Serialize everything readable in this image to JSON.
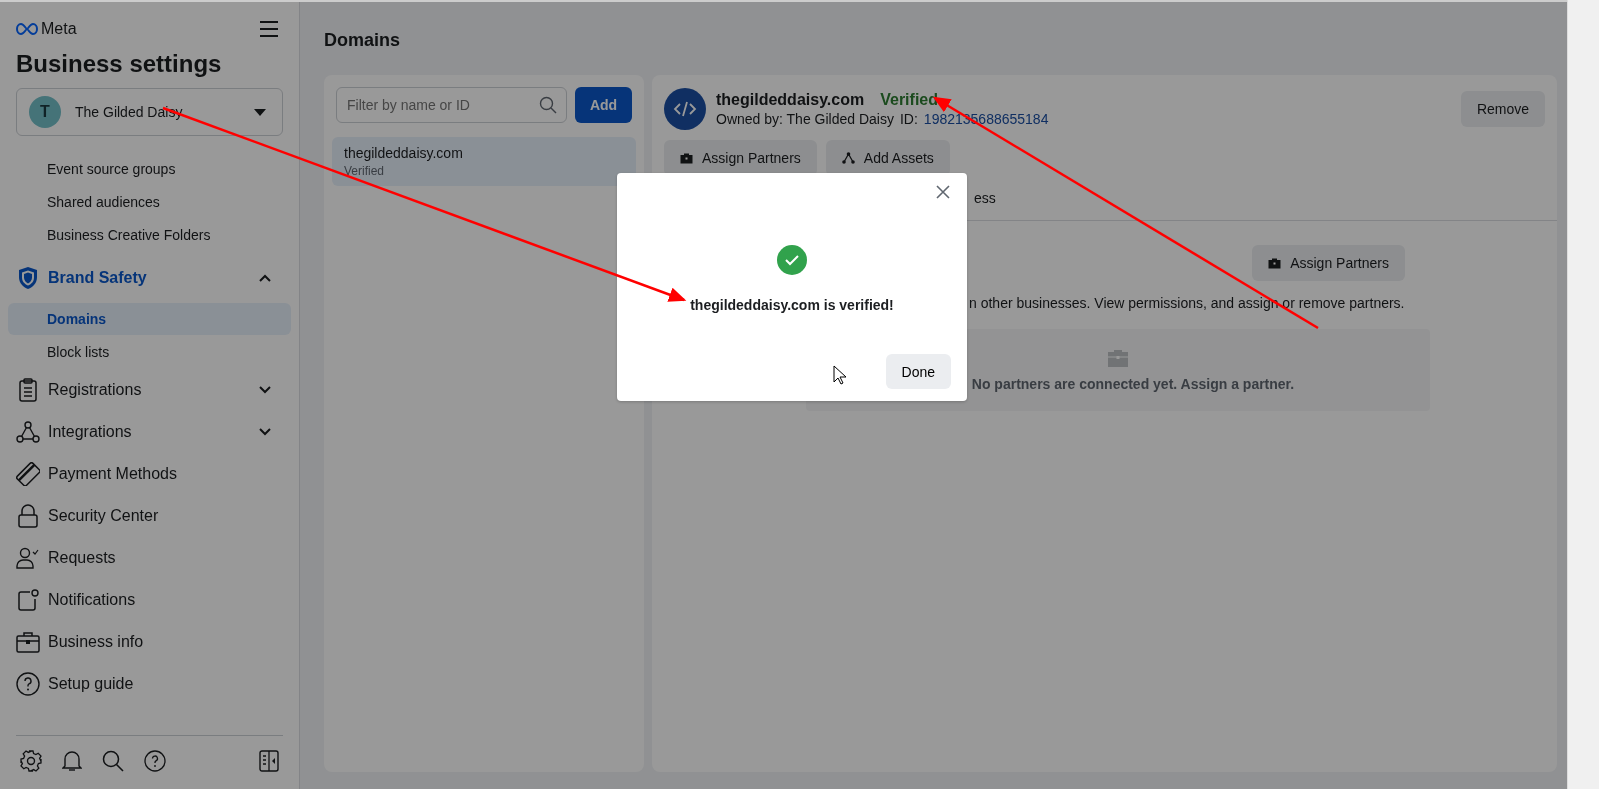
{
  "brand": {
    "name": "Meta"
  },
  "sidebar": {
    "title": "Business settings",
    "account": {
      "initial": "T",
      "name": "The Gilded Daisy"
    },
    "items": [
      {
        "kind": "sub",
        "label": "Event source groups",
        "selected": false
      },
      {
        "kind": "sub",
        "label": "Shared audiences",
        "selected": false
      },
      {
        "kind": "sub",
        "label": "Business Creative Folders",
        "selected": false
      },
      {
        "kind": "group",
        "label": "Brand Safety",
        "expanded": true
      },
      {
        "kind": "sub",
        "label": "Domains",
        "selected": true
      },
      {
        "kind": "sub",
        "label": "Block lists",
        "selected": false
      },
      {
        "kind": "group",
        "label": "Registrations",
        "expanded": false
      },
      {
        "kind": "group",
        "label": "Integrations",
        "expanded": false
      },
      {
        "kind": "link",
        "label": "Payment Methods"
      },
      {
        "kind": "link",
        "label": "Security Center"
      },
      {
        "kind": "link",
        "label": "Requests"
      },
      {
        "kind": "link",
        "label": "Notifications"
      },
      {
        "kind": "link",
        "label": "Business info"
      },
      {
        "kind": "link",
        "label": "Setup guide"
      }
    ]
  },
  "page_title": "Domains",
  "list": {
    "search": {
      "placeholder": "Filter by name or ID"
    },
    "add_button": "Add",
    "domains": [
      {
        "name": "thegildeddaisy.com",
        "status": "Verified",
        "selected": true
      }
    ]
  },
  "detail": {
    "name": "thegildeddaisy.com",
    "status": "Verified",
    "owner": "Owned by: The Gilded Daisy",
    "id_label": "ID:",
    "id": "1982135688655184",
    "actions": [
      "Assign Partners",
      "Add Assets"
    ],
    "remove_button": "Remove",
    "tab_fragment": "ess",
    "assign_button": "Assign Partners",
    "description": "n other businesses. View permissions, and assign or remove partners.",
    "empty_text": "No partners are connected yet. Assign a partner."
  },
  "modal": {
    "message": "thegildeddaisy.com is verified!",
    "button": "Done"
  }
}
